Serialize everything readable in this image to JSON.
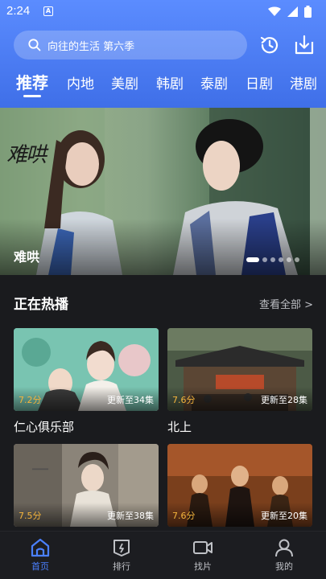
{
  "status_bar": {
    "time": "2:24",
    "notification_icon": "A"
  },
  "search": {
    "placeholder": "向往的生活 第六季"
  },
  "tabs": [
    {
      "label": "推荐",
      "active": true
    },
    {
      "label": "内地"
    },
    {
      "label": "美剧"
    },
    {
      "label": "韩剧"
    },
    {
      "label": "泰剧"
    },
    {
      "label": "日剧"
    },
    {
      "label": "港剧"
    }
  ],
  "banner": {
    "title": "难哄",
    "calligraphy": "难哄",
    "slide_count": 7,
    "active_slide": 1
  },
  "hot": {
    "title": "正在热播",
    "see_all": "查看全部 >",
    "items": [
      {
        "title": "仁心俱乐部",
        "rating": "7.2分",
        "episode": "更新至34集"
      },
      {
        "title": "北上",
        "rating": "7.6分",
        "episode": "更新至28集"
      },
      {
        "title": "",
        "rating": "7.5分",
        "episode": "更新至38集"
      },
      {
        "title": "",
        "rating": "7.6分",
        "episode": "更新至20集"
      }
    ]
  },
  "bottom_nav": [
    {
      "label": "首页",
      "icon": "home-icon",
      "active": true
    },
    {
      "label": "排行",
      "icon": "ranking-icon"
    },
    {
      "label": "找片",
      "icon": "video-icon"
    },
    {
      "label": "我的",
      "icon": "profile-icon"
    }
  ],
  "colors": {
    "accent": "#4a80ff",
    "header": "#4f7ff5",
    "rating": "#f4b43c",
    "background": "#1a1b1e"
  }
}
